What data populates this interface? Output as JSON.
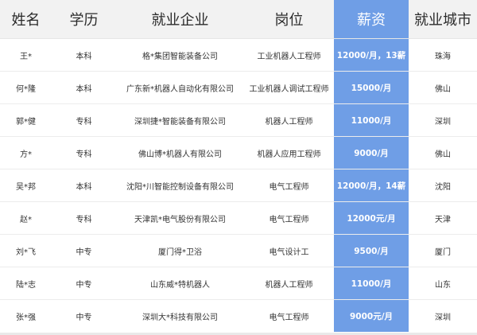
{
  "headers": {
    "name": "姓名",
    "education": "学历",
    "company": "就业企业",
    "position": "岗位",
    "salary": "薪资",
    "city": "就业城市"
  },
  "rows": [
    {
      "name": "王*",
      "education": "本科",
      "company": "格*集团智能装备公司",
      "position": "工业机器人工程师",
      "salary": "12000/月，13薪",
      "city": "珠海"
    },
    {
      "name": "何*隆",
      "education": "本科",
      "company": "广东新*机器人自动化有限公司",
      "position": "工业机器人调试工程师",
      "salary": "15000/月",
      "city": "佛山"
    },
    {
      "name": "郭*健",
      "education": "专科",
      "company": "深圳捷*智能装备有限公司",
      "position": "机器人工程师",
      "salary": "11000/月",
      "city": "深圳"
    },
    {
      "name": "方*",
      "education": "专科",
      "company": "佛山博*机器人有限公司",
      "position": "机器人应用工程师",
      "salary": "9000/月",
      "city": "佛山"
    },
    {
      "name": "吴*邦",
      "education": "本科",
      "company": "沈阳*川智能控制设备有限公司",
      "position": "电气工程师",
      "salary": "12000/月，14薪",
      "city": "沈阳"
    },
    {
      "name": "赵*",
      "education": "专科",
      "company": "天津凯*电气股份有限公司",
      "position": "电气工程师",
      "salary": "12000元/月",
      "city": "天津"
    },
    {
      "name": "刘*飞",
      "education": "中专",
      "company": "厦门得*卫浴",
      "position": "电气设计工",
      "salary": "9500/月",
      "city": "厦门"
    },
    {
      "name": "陆*志",
      "education": "中专",
      "company": "山东威*特机器人",
      "position": "机器人工程师",
      "salary": "11000/月",
      "city": "山东"
    },
    {
      "name": "张*强",
      "education": "中专",
      "company": "深圳大*科技有限公司",
      "position": "电气工程师",
      "salary": "9000元/月",
      "city": "深圳"
    }
  ],
  "colors": {
    "header_bg": "#f2f2f2",
    "highlight": "#6f9ee6",
    "highlight_text": "#ffffff"
  }
}
